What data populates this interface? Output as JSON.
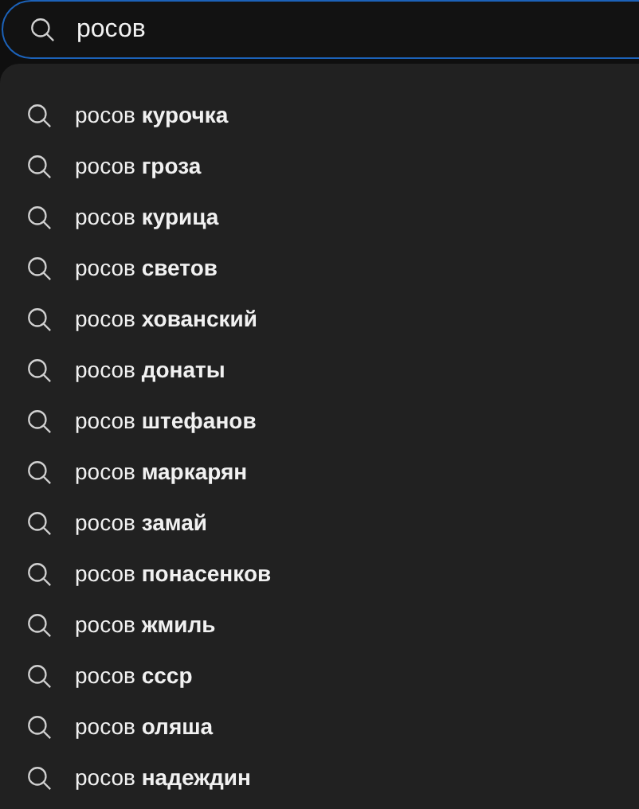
{
  "search": {
    "value": "росов"
  },
  "suggestions": [
    "росов **курочка**",
    "росов **гроза**",
    "росов **курица**",
    "росов **светов**",
    "росов **хованский**",
    "росов **донаты**",
    "росов **штефанов**",
    "росов **маркарян**",
    "росов **замай**",
    "росов **понасенков**",
    "росов **жмиль**",
    "росов **ссср**",
    "росов **оляша**",
    "росов **надеждин**"
  ]
}
